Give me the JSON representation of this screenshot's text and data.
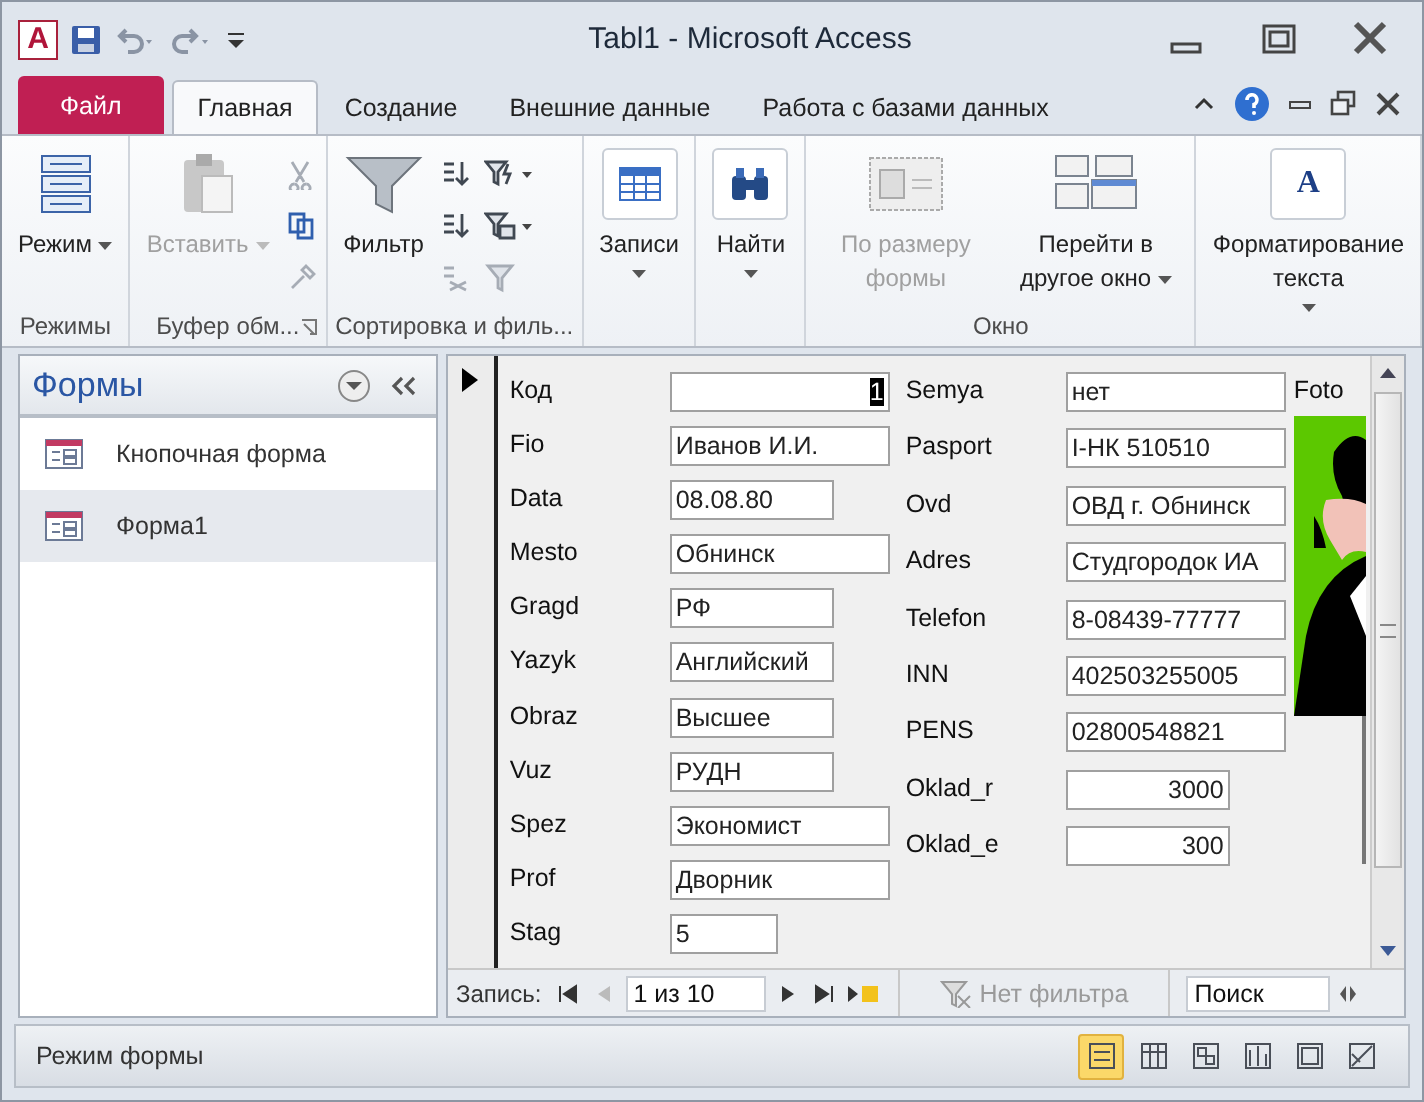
{
  "window": {
    "app_icon_letter": "A",
    "title": "Tabl1  -  Microsoft Access"
  },
  "tabs": [
    {
      "label": "Файл",
      "kind": "file",
      "selected": false
    },
    {
      "label": "Главная",
      "kind": "tab",
      "selected": true
    },
    {
      "label": "Создание",
      "kind": "tab",
      "selected": false
    },
    {
      "label": "Внешние данные",
      "kind": "tab",
      "selected": false
    },
    {
      "label": "Работа с базами данных",
      "kind": "tab",
      "selected": false
    }
  ],
  "ribbon": [
    {
      "label": "Режимы",
      "launcher": false,
      "items": [
        {
          "kind": "large",
          "label": "Режим",
          "dropdown": true,
          "disabled": false
        }
      ]
    },
    {
      "label": "Буфер обм...",
      "launcher": true,
      "items": [
        {
          "kind": "large",
          "label": "Вставить",
          "dropdown": true,
          "disabled": true
        },
        {
          "kind": "small",
          "dropdown": false,
          "disabled": true
        },
        {
          "kind": "small",
          "dropdown": false,
          "disabled": false
        },
        {
          "kind": "small",
          "dropdown": false,
          "disabled": true
        }
      ]
    },
    {
      "label": "Сортировка и филь...",
      "launcher": false,
      "items": [
        {
          "kind": "large",
          "label": "Фильтр",
          "dropdown": false,
          "disabled": false
        },
        {
          "kind": "small",
          "dropdown": false,
          "disabled": false
        },
        {
          "kind": "small",
          "dropdown": false,
          "disabled": false
        },
        {
          "kind": "small",
          "dropdown": false,
          "disabled": true
        },
        {
          "kind": "small",
          "dropdown": true,
          "disabled": false
        },
        {
          "kind": "small",
          "dropdown": true,
          "disabled": false
        },
        {
          "kind": "small",
          "dropdown": false,
          "disabled": true
        }
      ]
    },
    {
      "items": [
        {
          "kind": "boxed",
          "label": "Записи",
          "dropdown": true,
          "disabled": false
        }
      ]
    },
    {
      "items": [
        {
          "kind": "boxed",
          "label": "Найти",
          "dropdown": true,
          "disabled": false
        }
      ]
    },
    {
      "label": "Окно",
      "launcher": false,
      "items": [
        {
          "kind": "large",
          "label": "По размеру формы",
          "dropdown": false,
          "disabled": true
        },
        {
          "kind": "large",
          "label": "Перейти в другое окно",
          "dropdown": true,
          "disabled": false
        }
      ]
    },
    {
      "items": [
        {
          "kind": "boxed",
          "glyph": "A",
          "label": "Форматирование текста",
          "dropdown": true,
          "disabled": false
        }
      ]
    }
  ],
  "navigation_pane": {
    "title": "Формы",
    "items": [
      {
        "label": "Кнопочная форма",
        "selected": false
      },
      {
        "label": "Форма1",
        "selected": true
      }
    ]
  },
  "form": {
    "left_fields": [
      {
        "label": "Код",
        "value": "1",
        "numeric": true,
        "focused": true
      },
      {
        "label": "Fio",
        "value": "Иванов И.И.",
        "numeric": false,
        "focused": false
      },
      {
        "label": "Data",
        "value": "08.08.80",
        "numeric": false,
        "focused": false
      },
      {
        "label": "Mesto",
        "value": "Обнинск",
        "numeric": false,
        "focused": false
      },
      {
        "label": "Gragd",
        "value": "РФ",
        "numeric": false,
        "focused": false
      },
      {
        "label": "Yazyk",
        "value": "Английский",
        "numeric": false,
        "focused": false
      },
      {
        "label": "Obraz",
        "value": "Высшее",
        "numeric": false,
        "focused": false
      },
      {
        "label": "Vuz",
        "value": "РУДН",
        "numeric": false,
        "focused": false
      },
      {
        "label": "Spez",
        "value": "Экономист",
        "numeric": false,
        "focused": false
      },
      {
        "label": "Prof",
        "value": "Дворник",
        "numeric": false,
        "focused": false
      },
      {
        "label": "Stag",
        "value": "5",
        "numeric": false,
        "focused": false
      }
    ],
    "right_fields": [
      {
        "label": "Semya",
        "value": "нет",
        "numeric": false,
        "focused": false
      },
      {
        "label": "Pasport",
        "value": "I-НК 510510",
        "numeric": false,
        "focused": false
      },
      {
        "label": "Ovd",
        "value": "ОВД г. Обнинск",
        "numeric": false,
        "focused": false
      },
      {
        "label": "Adres",
        "value": "Студгородок ИА",
        "numeric": false,
        "focused": false
      },
      {
        "label": "Telefon",
        "value": "8-08439-77777",
        "numeric": false,
        "focused": false
      },
      {
        "label": "INN",
        "value": "402503255005",
        "numeric": false,
        "focused": false
      },
      {
        "label": "PENS",
        "value": "02800548821",
        "numeric": false,
        "focused": false
      },
      {
        "label": "Oklad_r",
        "value": "3000",
        "numeric": true,
        "focused": false
      },
      {
        "label": "Oklad_e",
        "value": "300",
        "numeric": true,
        "focused": false
      }
    ],
    "photo": {
      "label": "Foto",
      "kind": "picture"
    }
  },
  "record_navigator": {
    "label": "Запись:",
    "position": "1 из 10",
    "filter": "Нет фильтра",
    "search_placeholder": "Поиск"
  },
  "status_bar": {
    "text": "Режим формы",
    "views": [
      {
        "selected": true
      },
      {
        "selected": false
      },
      {
        "selected": false
      },
      {
        "selected": false
      },
      {
        "selected": false
      },
      {
        "selected": false
      }
    ]
  }
}
